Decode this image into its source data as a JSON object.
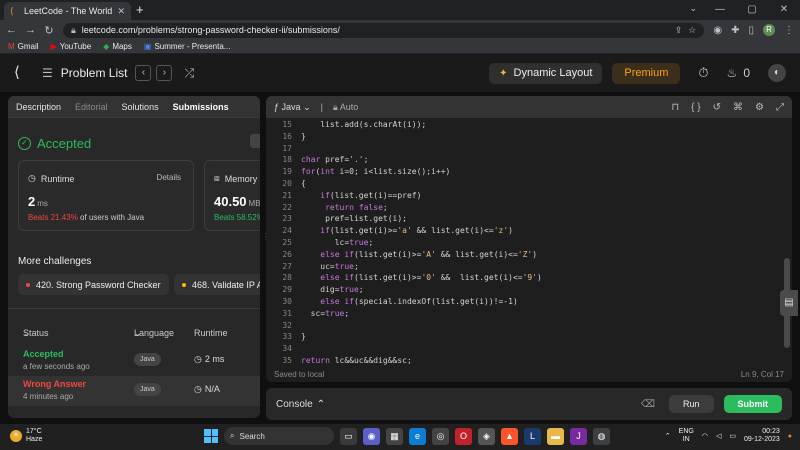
{
  "browser": {
    "tab_title": "LeetCode - The World's Leading",
    "url": "leetcode.com/problems/strong-password-checker-ii/submissions/",
    "profile_letter": "R",
    "bookmarks": [
      {
        "label": "Gmail",
        "icon": "gmail-icon"
      },
      {
        "label": "YouTube",
        "icon": "youtube-icon"
      },
      {
        "label": "Maps",
        "icon": "maps-icon"
      },
      {
        "label": "Summer - Presenta...",
        "icon": "slides-icon"
      }
    ]
  },
  "header": {
    "problem_list": "Problem List",
    "dynamic_layout": "Dynamic Layout",
    "premium": "Premium",
    "streak_count": "0"
  },
  "tabs": {
    "description": "Description",
    "editorial": "Editorial",
    "solutions": "Solutions",
    "submissions": "Submissions"
  },
  "result": {
    "status": "Accepted",
    "runtime_label": "Runtime",
    "details": "Details",
    "runtime_value": "2",
    "runtime_unit": "ms",
    "runtime_beats_prefix": "Beats ",
    "runtime_beats_pct": "21.43%",
    "runtime_beats_suffix": " of users with Java",
    "memory_label": "Memory",
    "memory_value": "40.50",
    "memory_unit": "MB",
    "memory_beats": "Beats 58.52%"
  },
  "more_challenges": {
    "title": "More challenges",
    "items": [
      {
        "label": "420. Strong Password Checker",
        "color": "#ef4743"
      },
      {
        "label": "468. Validate IP A",
        "color": "#ffb800"
      }
    ]
  },
  "submissions_table": {
    "headers": {
      "status": "Status",
      "language": "Language",
      "runtime": "Runtime"
    },
    "rows": [
      {
        "status": "Accepted",
        "time": "a few seconds ago",
        "language": "Java",
        "runtime": "2 ms",
        "color": "#2cbb5d"
      },
      {
        "status": "Wrong Answer",
        "time": "4 minutes ago",
        "language": "Java",
        "runtime": "N/A",
        "color": "#ef4743"
      }
    ]
  },
  "editor": {
    "language": "Java",
    "mode": "Auto",
    "saved": "Saved to local",
    "cursor": "Ln 9, Col 17",
    "lines": [
      {
        "n": "15",
        "code": "    list.add(s.charAt(i));"
      },
      {
        "n": "16",
        "code": "}"
      },
      {
        "n": "17",
        "code": ""
      },
      {
        "n": "18",
        "code": "char pref='.';"
      },
      {
        "n": "19",
        "code": "for(int i=0; i<list.size();i++)"
      },
      {
        "n": "20",
        "code": "{"
      },
      {
        "n": "21",
        "code": "    if(list.get(i)==pref)"
      },
      {
        "n": "22",
        "code": "     return false;"
      },
      {
        "n": "23",
        "code": "     pref=list.get(i);"
      },
      {
        "n": "24",
        "code": "    if(list.get(i)>='a' && list.get(i)<='z')"
      },
      {
        "n": "25",
        "code": "       lc=true;"
      },
      {
        "n": "26",
        "code": "    else if(list.get(i)>='A' && list.get(i)<='Z')"
      },
      {
        "n": "27",
        "code": "    uc=true;"
      },
      {
        "n": "28",
        "code": "    else if(list.get(i)>='0' &&  list.get(i)<='9')"
      },
      {
        "n": "29",
        "code": "    dig=true;"
      },
      {
        "n": "30",
        "code": "    else if(special.indexOf(list.get(i))!=-1)"
      },
      {
        "n": "31",
        "code": "  sc=true;"
      },
      {
        "n": "32",
        "code": ""
      },
      {
        "n": "33",
        "code": "}"
      },
      {
        "n": "34",
        "code": ""
      },
      {
        "n": "35",
        "code": "return lc&&uc&&dig&&sc;"
      }
    ]
  },
  "console": {
    "label": "Console",
    "run": "Run",
    "submit": "Submit"
  },
  "taskbar": {
    "temp": "17°C",
    "weather": "Haze",
    "search": "Search",
    "lang_1": "ENG",
    "lang_2": "IN",
    "time": "00:23",
    "date": "09-12-2023"
  }
}
